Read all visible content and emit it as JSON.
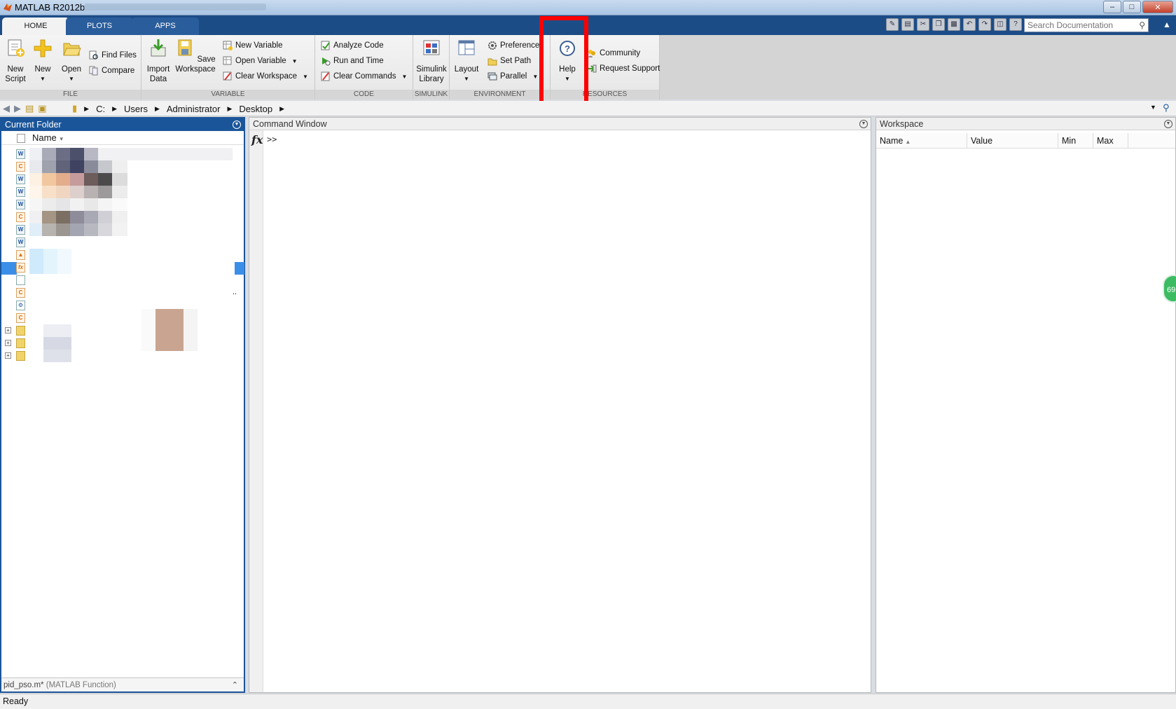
{
  "window": {
    "title": "MATLAB R2012b"
  },
  "tabs": [
    {
      "label": "HOME"
    },
    {
      "label": "PLOTS"
    },
    {
      "label": "APPS"
    }
  ],
  "search_documentation": {
    "placeholder": "Search Documentation"
  },
  "ribbon": {
    "file": {
      "label": "FILE",
      "new_script": [
        "New",
        "Script"
      ],
      "new": "New",
      "open": "Open",
      "find_files": "Find Files",
      "compare": "Compare"
    },
    "variable": {
      "label": "VARIABLE",
      "import_data": [
        "Import",
        "Data"
      ],
      "save_workspace": [
        "Save",
        "Workspace"
      ],
      "new_variable": "New Variable",
      "open_variable": "Open Variable",
      "clear_workspace": "Clear Workspace"
    },
    "code": {
      "label": "CODE",
      "analyze_code": "Analyze Code",
      "run_and_time": "Run and Time",
      "clear_commands": "Clear Commands"
    },
    "simulink": {
      "label": "SIMULINK",
      "simulink_library": [
        "Simulink",
        "Library"
      ]
    },
    "environment": {
      "label": "ENVIRONMENT",
      "layout": "Layout",
      "preferences": "Preferences",
      "set_path": "Set Path",
      "parallel": "Parallel"
    },
    "resources": {
      "label": "RESOURCES",
      "help": "Help",
      "community": "Community",
      "request_support": "Request Support"
    }
  },
  "address_bar": {
    "path": [
      "C:",
      "Users",
      "Administrator",
      "Desktop"
    ]
  },
  "current_folder": {
    "title": "Current Folder",
    "column_name": "Name",
    "footer_file": "pid_pso.m*",
    "footer_kind": "(MATLAB Function)",
    "ellipsis": ".."
  },
  "command_window": {
    "title": "Command Window",
    "fx": "fx",
    "prompt": ">>"
  },
  "workspace": {
    "title": "Workspace",
    "columns": [
      "Name",
      "Value",
      "Min",
      "Max"
    ]
  },
  "side_badge": "69",
  "status": "Ready"
}
